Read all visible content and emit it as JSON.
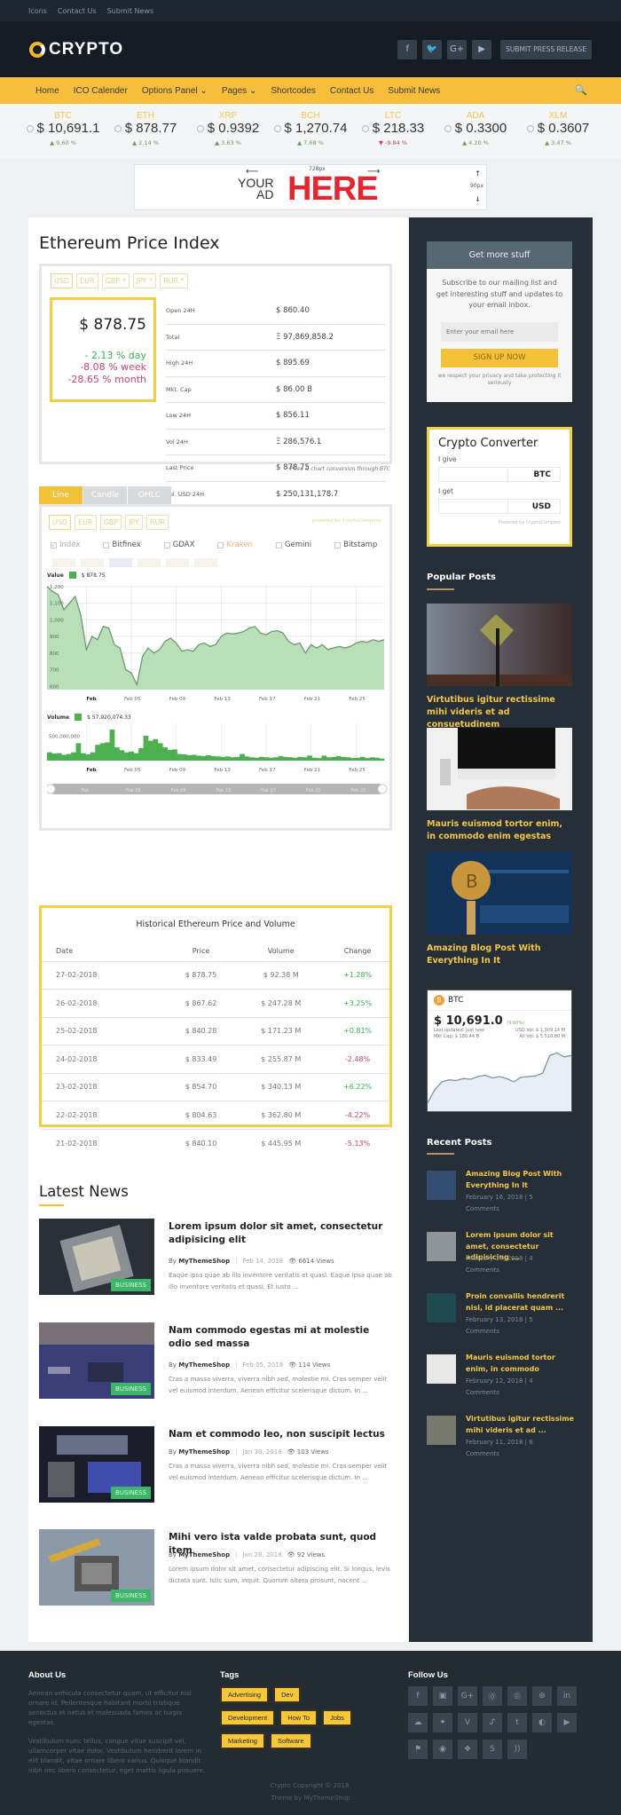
{
  "topbar": {
    "links": [
      "Icons",
      "Contact Us",
      "Submit News"
    ]
  },
  "header": {
    "logo_text": "CRYPTO",
    "social": [
      {
        "icon": "facebook-icon",
        "glyph": "f"
      },
      {
        "icon": "twitter-icon",
        "glyph": "🐦"
      },
      {
        "icon": "google-plus-icon",
        "glyph": "G+"
      },
      {
        "icon": "youtube-icon",
        "glyph": "▶"
      }
    ],
    "press_button": "SUBMIT PRESS RELEASE"
  },
  "nav": {
    "items": [
      "Home",
      "ICO Calender",
      "Options Panel ⌄",
      "Pages ⌄",
      "Shortcodes",
      "Contact Us",
      "Submit News"
    ],
    "search_icon": "🔍"
  },
  "ticker": [
    {
      "symbol": "BTC",
      "price": "$ 10,691.1",
      "change": "9.60 %",
      "dir": "up"
    },
    {
      "symbol": "ETH",
      "price": "$ 878.77",
      "change": "2.14 %",
      "dir": "up"
    },
    {
      "symbol": "XRP",
      "price": "$ 0.9392",
      "change": "3.63 %",
      "dir": "up"
    },
    {
      "symbol": "BCH",
      "price": "$ 1,270.74",
      "change": "7.68 %",
      "dir": "up"
    },
    {
      "symbol": "LTC",
      "price": "$ 218.33",
      "change": "-9.84 %",
      "dir": "down"
    },
    {
      "symbol": "ADA",
      "price": "$ 0.3300",
      "change": "4.10 %",
      "dir": "up"
    },
    {
      "symbol": "XLM",
      "price": "$ 0.3607",
      "change": "3.47 %",
      "dir": "up"
    }
  ],
  "ad": {
    "your": "YOUR",
    "ad": "AD",
    "here": "HERE",
    "width_label": "728px",
    "height_label": "90px"
  },
  "price_index": {
    "title": "Ethereum Price Index",
    "currencies": [
      "USD",
      "EUR",
      "GBP *",
      "JPY *",
      "RUR *"
    ],
    "price": "$ 878.75",
    "day": "- 2.13 % day",
    "week": "-8.08 % week",
    "month": "-28.65 % month",
    "stats": [
      {
        "label": "Open 24H",
        "value": "$ 860.40"
      },
      {
        "label": "Total",
        "value": "Ξ 97,869,858.2"
      },
      {
        "label": "High 24H",
        "value": "$ 895.69"
      },
      {
        "label": "Mkt. Cap",
        "value": "$ 86.00 B"
      },
      {
        "label": "Low 24H",
        "value": "$ 856.11"
      },
      {
        "label": "Vol 24H",
        "value": "Ξ 286,576.1"
      },
      {
        "label": "Last Price",
        "value": "$ 878.75"
      },
      {
        "label": "Vol. USD 24H",
        "value": "$ 250,131,178.7"
      }
    ],
    "note": "* Price & chart conversion through BTC"
  },
  "chart_widget": {
    "tabs": [
      "Line",
      "Candle",
      "OHLC"
    ],
    "currencies": [
      "USD",
      "EUR",
      "GBP",
      "JPY",
      "RUR"
    ],
    "powered_by": "powered by CryptoCompare",
    "exchanges": [
      {
        "name": "Index",
        "checked": true
      },
      {
        "name": "Bitfinex",
        "checked": false
      },
      {
        "name": "GDAX",
        "checked": false
      },
      {
        "name": "Kraken",
        "checked": false
      },
      {
        "name": "Gemini",
        "checked": false
      },
      {
        "name": "Bitstamp",
        "checked": false
      }
    ],
    "value_label": "Value",
    "value_reading": "$ 878.75",
    "volume_label": "Volume",
    "volume_reading": "$ 57,920,074.33"
  },
  "chart_data": [
    {
      "type": "area",
      "title": "Value",
      "xlabel": "",
      "ylabel": "",
      "x_ticks": [
        "Feb",
        "Feb 05",
        "Feb 09",
        "Feb 13",
        "Feb 17",
        "Feb 21",
        "Feb 25"
      ],
      "y_ticks": [
        600,
        700,
        800,
        900,
        1000,
        1100,
        1200
      ],
      "ylim": [
        580,
        1210
      ],
      "grid": true,
      "color": "#4caf50",
      "x_days": [
        -3.5,
        -3,
        -2.5,
        -2,
        -1.5,
        -1,
        -0.5,
        0,
        0.5,
        1,
        1.5,
        2,
        2.5,
        3,
        3.5,
        4,
        4.5,
        5,
        5.5,
        6,
        6.5,
        7,
        7.5,
        8,
        8.5,
        9,
        9.5,
        10,
        10.5,
        11,
        11.5,
        12,
        12.5,
        13,
        13.5,
        14,
        14.5,
        15,
        15.5,
        16,
        16.5,
        17,
        17.5,
        18,
        18.5,
        19,
        19.5,
        20,
        20.5,
        21,
        21.5,
        22,
        22.5,
        23,
        23.5,
        24,
        24.5,
        25,
        25.5,
        26,
        26.5
      ],
      "values": [
        1200,
        1170,
        1150,
        1060,
        1100,
        1140,
        1030,
        820,
        900,
        880,
        960,
        950,
        850,
        830,
        700,
        680,
        610,
        780,
        830,
        800,
        820,
        870,
        890,
        860,
        810,
        820,
        810,
        850,
        860,
        840,
        850,
        900,
        920,
        915,
        920,
        930,
        950,
        960,
        920,
        910,
        930,
        935,
        920,
        870,
        850,
        860,
        800,
        850,
        830,
        850,
        820,
        830,
        840,
        830,
        840,
        860,
        870,
        865,
        880,
        870,
        880
      ]
    },
    {
      "type": "bar",
      "title": "Volume",
      "x_ticks": [
        "Feb",
        "Feb 05",
        "Feb 09",
        "Feb 13",
        "Feb 17",
        "Feb 21",
        "Feb 25"
      ],
      "y_ticks": [
        500000000
      ],
      "y_tick_labels": [
        "500,000,000"
      ],
      "ylim": [
        0,
        900000000
      ],
      "color": "#4caf50",
      "values": [
        200,
        170,
        180,
        140,
        160,
        200,
        420,
        180,
        150,
        200,
        380,
        420,
        440,
        750,
        320,
        250,
        200,
        220,
        180,
        300,
        600,
        480,
        520,
        420,
        320,
        260,
        270,
        160,
        150,
        130,
        140,
        120,
        110,
        130,
        110,
        100,
        90,
        100,
        80,
        90,
        160,
        100,
        80,
        70,
        90,
        80,
        70,
        80,
        110,
        90,
        80,
        70,
        90,
        80,
        120,
        70,
        60,
        120,
        80,
        90,
        110,
        90,
        80,
        60,
        70,
        90,
        60,
        80,
        70,
        50
      ]
    }
  ],
  "history": {
    "title": "Historical Ethereum Price and Volume",
    "headers": [
      "Date",
      "Price",
      "Volume",
      "Change"
    ],
    "rows": [
      [
        "27-02-2018",
        "$ 878.75",
        "$ 92.38 M",
        "+1.28%"
      ],
      [
        "26-02-2018",
        "$ 867.62",
        "$ 247.28 M",
        "+3.25%"
      ],
      [
        "25-02-2018",
        "$ 840.28",
        "$ 171.23 M",
        "+0.81%"
      ],
      [
        "24-02-2018",
        "$ 833.49",
        "$ 255.87 M",
        "-2.48%"
      ],
      [
        "23-02-2018",
        "$ 854.70",
        "$ 340.13 M",
        "+6.22%"
      ],
      [
        "22-02-2018",
        "$ 804.63",
        "$ 362.80 M",
        "-4.22%"
      ],
      [
        "21-02-2018",
        "$ 840.10",
        "$ 445.95 M",
        "-5.13%"
      ]
    ]
  },
  "latest_news": {
    "title": "Latest News",
    "items": [
      {
        "title": "Lorem ipsum dolor sit amet, consectetur adipisicing elit",
        "by": "By",
        "author": "MyThemeShop",
        "date": "Feb 14, 2018",
        "views": "6614 Views",
        "excerpt": "Eaque ipsa quae ab illo inventore veritatis et quasi. Eaque ipsa quae ab illo inventore veritatis et quasi. Et iusto ...",
        "badge": "BUSINESS"
      },
      {
        "title": "Nam commodo egestas mi at molestie odio sed massa",
        "by": "By",
        "author": "MyThemeShop",
        "date": "Feb 05, 2018",
        "views": "114 Views",
        "excerpt": "Cras a massa viverra, viverra nibh sed, molestie mi. Cras semper velit vel euismod interdum. Aenean efficitur scelerisque dictum. In ...",
        "badge": "BUSINESS"
      },
      {
        "title": "Nam et commodo leo, non suscipit lectus",
        "by": "By",
        "author": "MyThemeShop",
        "date": "Jan 30, 2018",
        "views": "103 Views",
        "excerpt": "Cras a massa viverra, viverra nibh sed, molestie mi. Cras semper velit vel euismod interdum. Aenean efficitur scelerisque dictum. In ...",
        "badge": "BUSINESS"
      },
      {
        "title": "Mihi vero ista valde probata sunt, quod item",
        "by": "By",
        "author": "MyThemeShop",
        "date": "Jan 26, 2018",
        "views": "92 Views",
        "excerpt": "Lorem ipsum dolor sit amet, consectetur adipiscing elit. Si longus, levis dictata sunt. Istic sum, inquit. Quorum altera prosunt, nocent ...",
        "badge": "BUSINESS"
      }
    ]
  },
  "sidebar": {
    "subscribe": {
      "title": "Get more stuff",
      "text": "Subscribe to our mailing list and get interesting stuff and updates to your email inbox.",
      "placeholder": "Enter your email here",
      "button": "SIGN UP NOW",
      "privacy": "we respect your privacy and take protecting it seriously"
    },
    "converter": {
      "title": "Crypto Converter",
      "give_label": "I give",
      "give_currency": "BTC",
      "get_label": "I get",
      "get_currency": "USD",
      "powered": "Powered by CryptoCompare"
    },
    "popular_title": "Popular Posts",
    "popular": [
      {
        "title": "Virtutibus igitur rectissime mihi videris et ad consuetudinem"
      },
      {
        "title": "Mauris euismod tortor enim, in commodo enim egestas"
      },
      {
        "title": "Amazing Blog Post With Everything In It"
      }
    ],
    "btc_widget": {
      "symbol": "BTC",
      "price": "$ 10,691.0",
      "change": "(9.60%)",
      "updated": "Last updated: just now",
      "usd_vol": "USD Vol: $ 1,309.14 M",
      "mkt_cap": "Mkt Cap: $ 180.44 B",
      "all_vol": "All Vol: $ 5,510.80 M",
      "spark": [
        10,
        30,
        42,
        45,
        44,
        47,
        46,
        50,
        52,
        48,
        50,
        47,
        42,
        49,
        50,
        51,
        55,
        82,
        86,
        80,
        82
      ]
    },
    "recent_title": "Recent Posts",
    "recent": [
      {
        "title": "Amazing Blog Post With Everything In It",
        "meta": "February 16, 2018 | 5 Comments"
      },
      {
        "title": "Lorem ipsum dolor sit amet, consectetur adipisicing ...",
        "meta": "February 14, 2018 | 4 Comments"
      },
      {
        "title": "Proin convallis hendrerit nisi, id placerat quam ...",
        "meta": "February 13, 2018 | 5 Comments"
      },
      {
        "title": "Mauris euismod tortor enim, in commodo",
        "meta": "February 12, 2018 | 4 Comments"
      },
      {
        "title": "Virtutibus igitur rectissime mihi videris et ad ...",
        "meta": "February 11, 2018 | 6 Comments"
      }
    ]
  },
  "footer": {
    "about_title": "About Us",
    "about_p1": "Aenean vehicula consectetur quam, ut efficitur nisl ornare id. Pellentesque habitant morbi tristique senectus et netus et malesuada fames ac turpis egestas.",
    "about_p2": "Vestibulum nunc tellus, congue vitae suscipit vel, ullamcorper vitae dolor. Vestibulum hendrerit lorem in elit blandit, vitae ornare libero varius. Quisque blandit nibh nec libero consectetur, eget mattis ligula posuere.",
    "tags_title": "Tags",
    "tags": [
      "Advertising",
      "Dev",
      "Development",
      "How To",
      "Jobs",
      "Marketing",
      "Software"
    ],
    "follow_title": "Follow Us",
    "follow": [
      {
        "icon": "facebook-icon",
        "glyph": "f"
      },
      {
        "icon": "flickr-icon",
        "glyph": "▣"
      },
      {
        "icon": "google-plus-icon",
        "glyph": "G+"
      },
      {
        "icon": "pinterest-icon",
        "glyph": "⓪"
      },
      {
        "icon": "instagram-icon",
        "glyph": "◎"
      },
      {
        "icon": "dribbble-icon",
        "glyph": "⊛"
      },
      {
        "icon": "linkedin-icon",
        "glyph": "in"
      },
      {
        "icon": "soundcloud-icon",
        "glyph": "☁"
      },
      {
        "icon": "twitter-icon",
        "glyph": "✦"
      },
      {
        "icon": "vine-icon",
        "glyph": "V"
      },
      {
        "icon": "stumbleupon-icon",
        "glyph": "ᔑ"
      },
      {
        "icon": "tumblr-icon",
        "glyph": "t"
      },
      {
        "icon": "github-icon",
        "glyph": "◐"
      },
      {
        "icon": "youtube-icon",
        "glyph": "▶"
      },
      {
        "icon": "foursquare-icon",
        "glyph": "⚑"
      },
      {
        "icon": "reddit-icon",
        "glyph": "◉"
      },
      {
        "icon": "dropbox-icon",
        "glyph": "❖"
      },
      {
        "icon": "skype-icon",
        "glyph": "S"
      },
      {
        "icon": "rss-icon",
        "glyph": "))"
      }
    ],
    "copyright": "Crypto Copyright © 2018.",
    "theme_by": "Theme by MyThemeShop"
  }
}
